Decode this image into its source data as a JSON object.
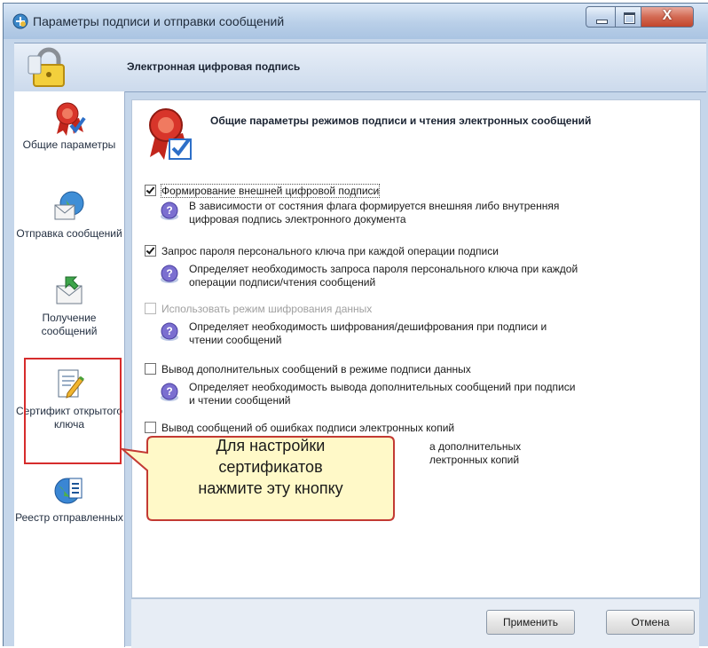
{
  "window": {
    "title": "Параметры подписи и отправки сообщений",
    "close_glyph": "X",
    "accent_color": "#c5d6ea"
  },
  "banner": {
    "title": "Электронная цифровая подпись",
    "icon": "lock-icon"
  },
  "sidebar": {
    "items": [
      {
        "label": "Общие параметры",
        "icon": "ribbon-badge-icon"
      },
      {
        "label": "Отправка сообщений",
        "icon": "envelope-globe-icon"
      },
      {
        "label": "Получение сообщений",
        "icon": "incoming-mail-icon"
      },
      {
        "label": "Сертификт открытого ключа",
        "icon": "certificate-edit-icon"
      },
      {
        "label": "Реестр отправленных",
        "icon": "registry-globe-icon"
      }
    ]
  },
  "panel": {
    "title": "Общие параметры режимов подписи и чтения электронных сообщений",
    "options": [
      {
        "label": "Формирование внешней цифровой подписи",
        "checked": true,
        "enabled": true,
        "help": "В зависимости от состяния флага формируется внешняя либо внутренняя цифровая подпись электронного документа"
      },
      {
        "label": "Запрос пароля персонального ключа при каждой операции подписи",
        "checked": true,
        "enabled": true,
        "help": "Определяет необходимость запроса пароля персонального ключа при каждой операции подписи/чтения сообщений"
      },
      {
        "label": "Использовать режим шифрования данных",
        "checked": false,
        "enabled": false,
        "help": "Определяет необходимость шифрования/дешифрования при подписи и чтении сообщений"
      },
      {
        "label": "Вывод дополнительных сообщений в режиме подписи данных",
        "checked": false,
        "enabled": true,
        "help": "Определяет необходимость вывода дополнительных сообщений при подписи и чтении сообщений"
      },
      {
        "label": "Вывод сообщений об ошибках подписи электронных копий",
        "checked": false,
        "enabled": true,
        "help_visible_1": "а дополнительных",
        "help_visible_2": "лектронных копий"
      }
    ]
  },
  "footer": {
    "apply_label": "Применить",
    "cancel_label": "Отмена"
  },
  "annotation": {
    "callout_text": "Для настройки сертификатов нажмите эту кнопку",
    "callout_line1": "Для настройки",
    "callout_line2": "сертификатов",
    "callout_line3": "нажмите эту кнопку",
    "highlight_color": "#d62c2c",
    "callout_fill": "#fff9c8"
  }
}
